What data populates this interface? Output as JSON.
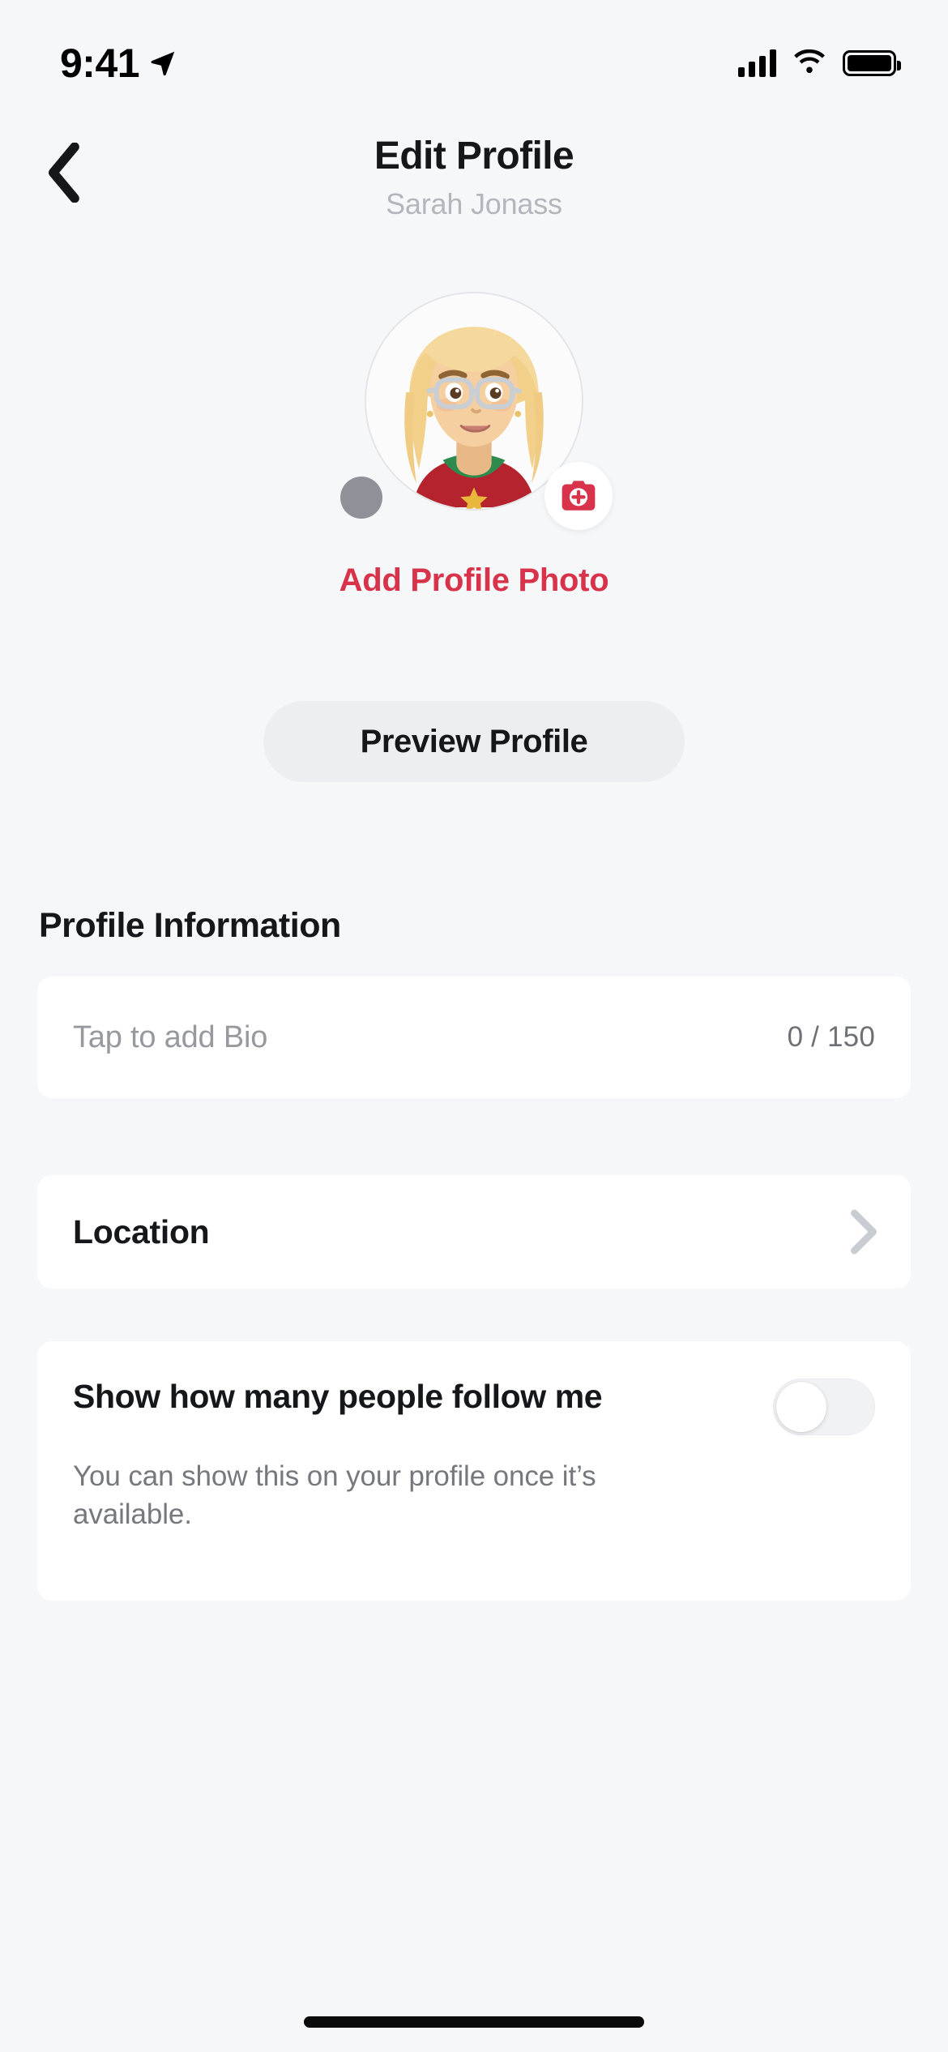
{
  "status_bar": {
    "time": "9:41",
    "location_icon": "location-arrow-icon",
    "cellular_icon": "cellular-bars-icon",
    "wifi_icon": "wifi-icon",
    "battery_icon": "battery-full-icon"
  },
  "nav": {
    "back_icon": "chevron-left-icon",
    "title": "Edit Profile",
    "subtitle": "Sarah Jonass"
  },
  "avatar": {
    "alt": "profile-avatar-illustration",
    "camera_badge_icon": "camera-plus-icon",
    "add_photo_label": "Add Profile Photo",
    "add_photo_color": "#D8334A",
    "badge_color": "#D8334A"
  },
  "preview": {
    "label": "Preview Profile"
  },
  "section": {
    "title": "Profile Information"
  },
  "bio": {
    "placeholder": "Tap to add Bio",
    "counter": "0 / 150",
    "count": 0,
    "max": 150
  },
  "location": {
    "label": "Location",
    "chevron_icon": "chevron-right-icon"
  },
  "follow": {
    "label": "Show how many people follow me",
    "description": "You can show this on your profile once it’s available.",
    "toggle_state": "off"
  },
  "home_indicator": "home-indicator-bar"
}
